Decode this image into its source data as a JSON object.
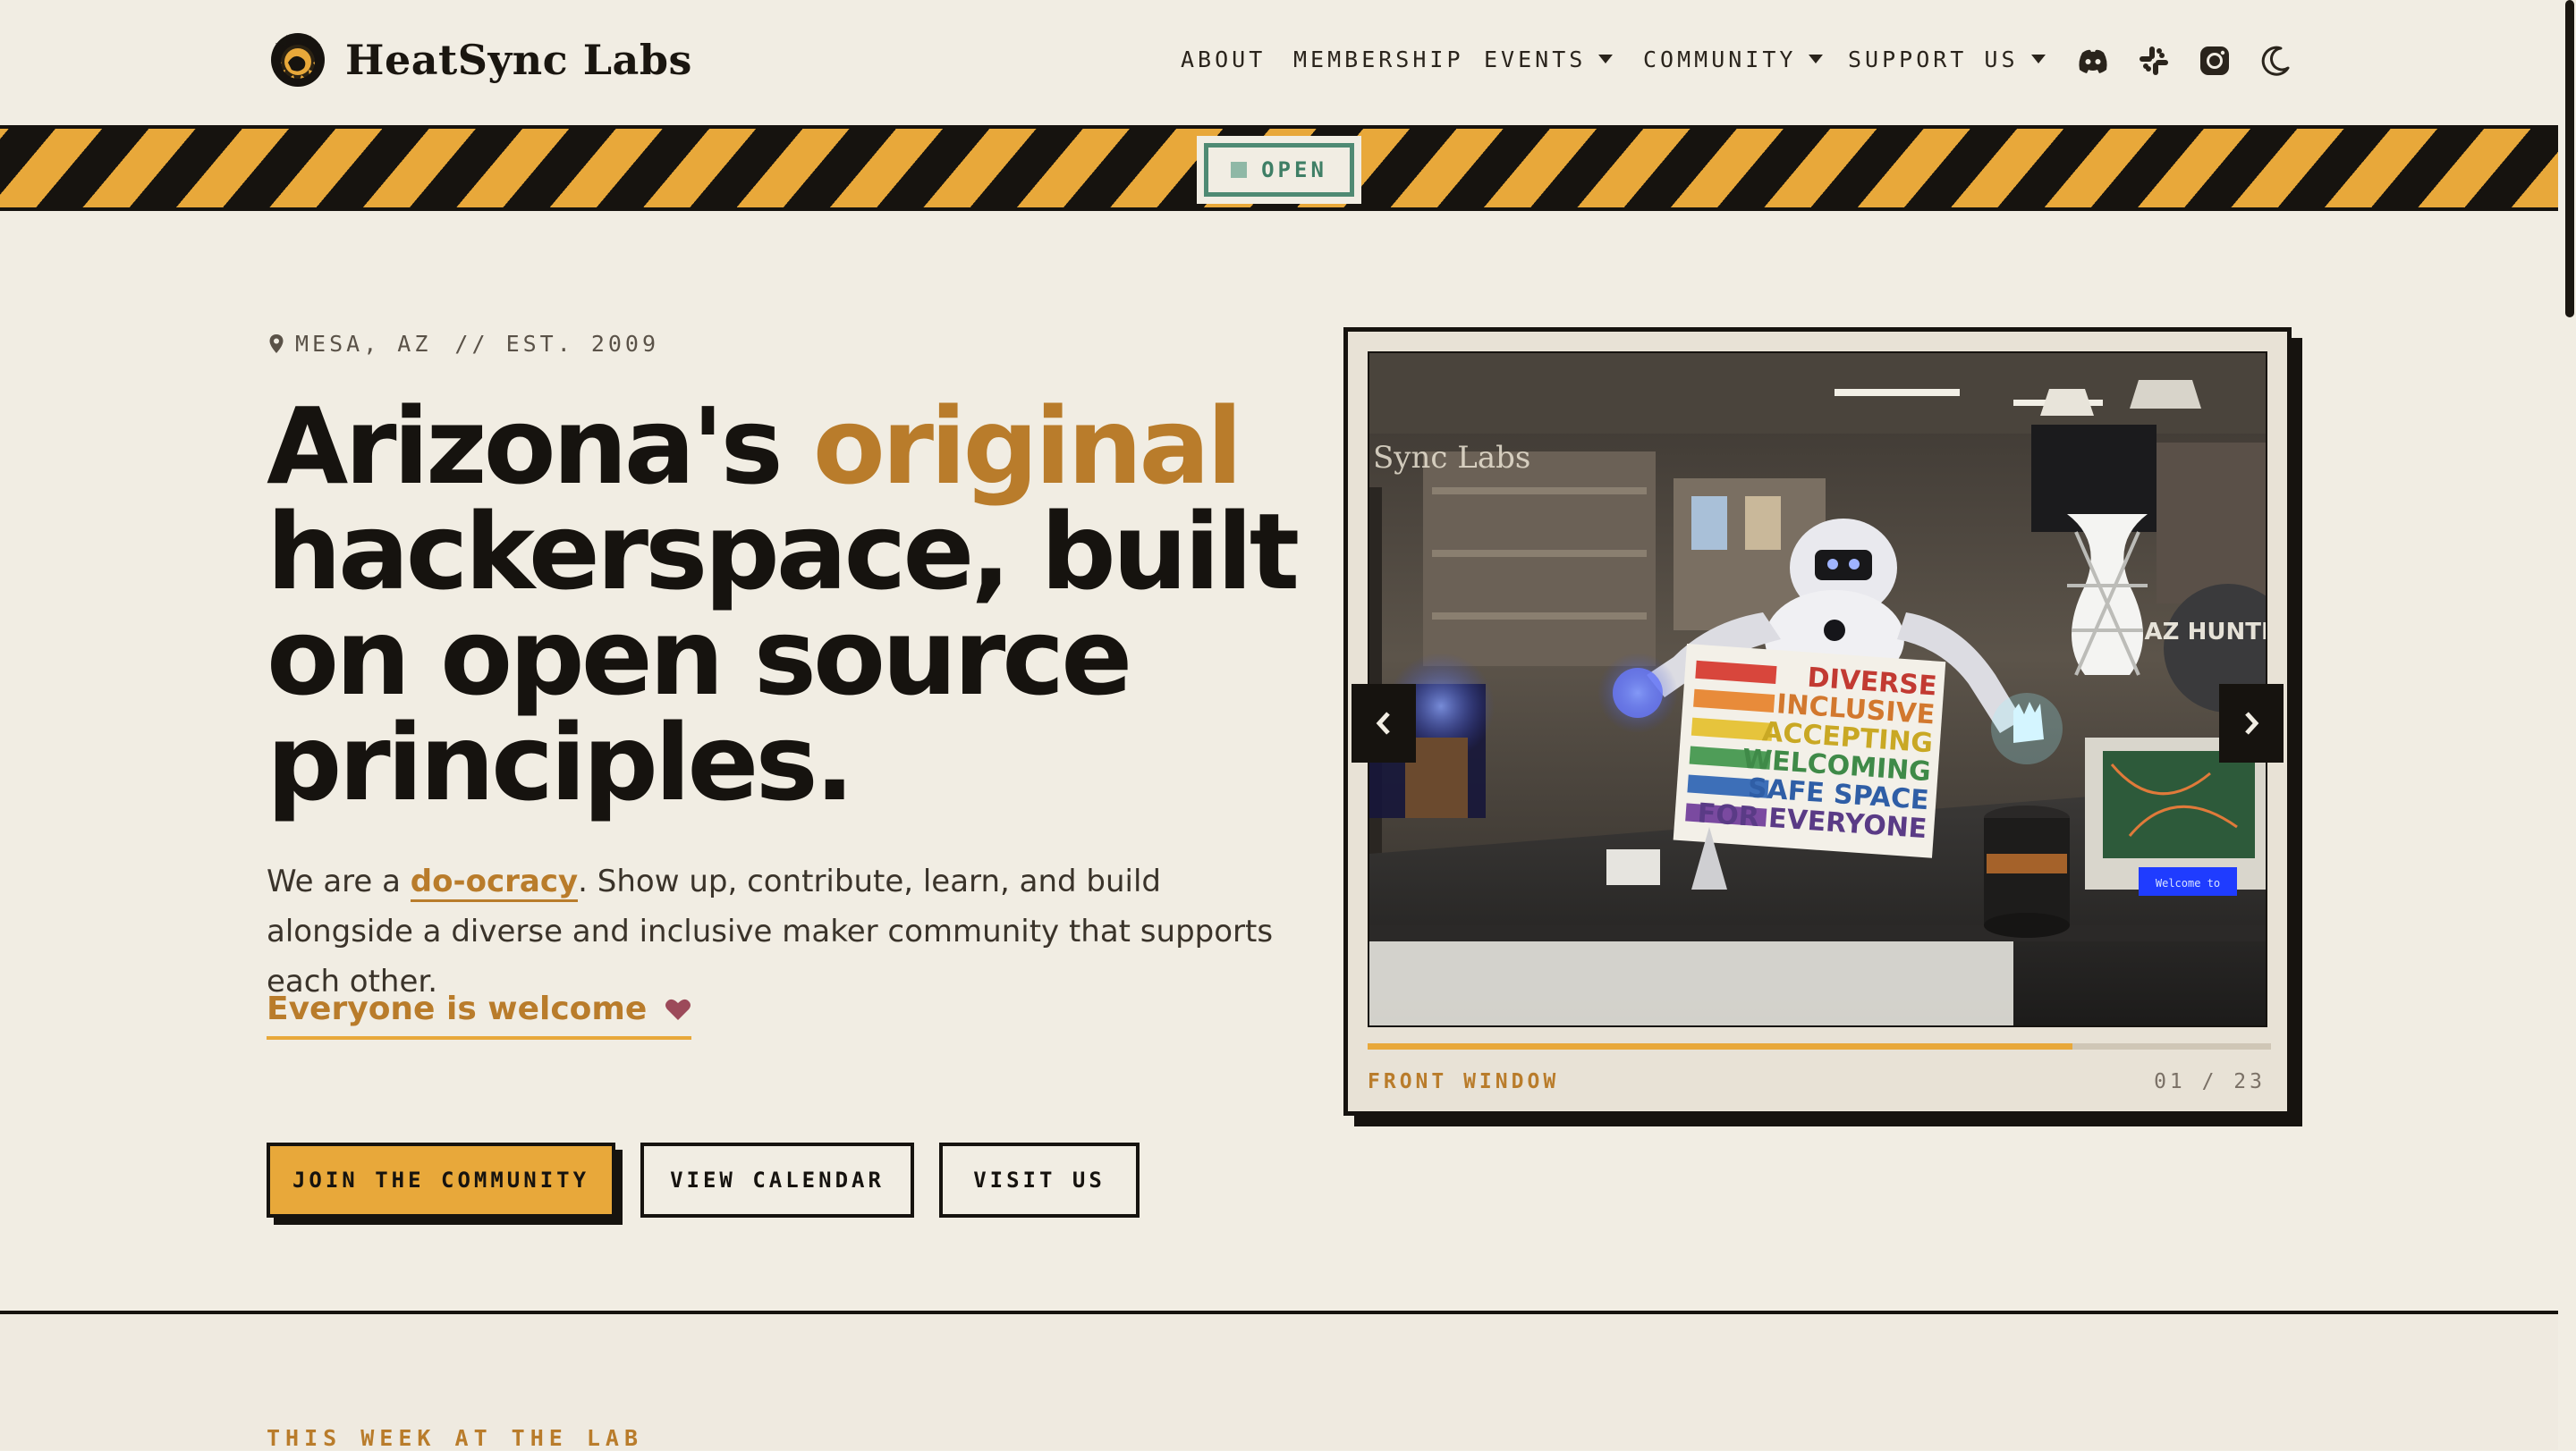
{
  "header": {
    "brand": "HeatSync Labs",
    "nav": [
      {
        "label": "ABOUT",
        "dropdown": false
      },
      {
        "label": "MEMBERSHIP",
        "dropdown": false
      },
      {
        "label": "EVENTS",
        "dropdown": true
      },
      {
        "label": "COMMUNITY",
        "dropdown": true
      },
      {
        "label": "SUPPORT US",
        "dropdown": true
      }
    ],
    "icons": [
      "discord-icon",
      "slack-icon",
      "instagram-icon",
      "moon-icon"
    ]
  },
  "status": {
    "label": "OPEN",
    "color": "#4f8a73"
  },
  "hero": {
    "location": "MESA, AZ",
    "established": "// EST. 2009",
    "headline_before": "Arizona's ",
    "headline_accent": "original",
    "headline_after": " hackerspace, built on open source principles.",
    "lede_before": "We are a ",
    "lede_link": "do-ocracy",
    "lede_after": ". Show up, contribute, learn, and build alongside a diverse and inclusive maker community that supports each other.",
    "welcome": "Everyone is welcome",
    "buttons": {
      "join": "JOIN THE COMMUNITY",
      "calendar": "VIEW CALENDAR",
      "visit": "VISIT US"
    }
  },
  "carousel": {
    "caption": "FRONT WINDOW",
    "counter": "01 / 23",
    "progress": 0.78,
    "sign_lines": [
      "DIVERSE",
      "INCLUSIVE",
      "ACCEPTING",
      "WELCOMING",
      "SAFE SPACE",
      "FOR EVERYONE"
    ],
    "window_text": "Sync Labs",
    "corner_sign": "AZ HUNTERS",
    "lcd_text": "Welcome to"
  },
  "section": {
    "label": "THIS WEEK AT THE LAB"
  },
  "colors": {
    "accent": "#b97c2b",
    "hazard": "#e8a83a",
    "ink": "#16130f",
    "paper": "#f1ede3"
  }
}
